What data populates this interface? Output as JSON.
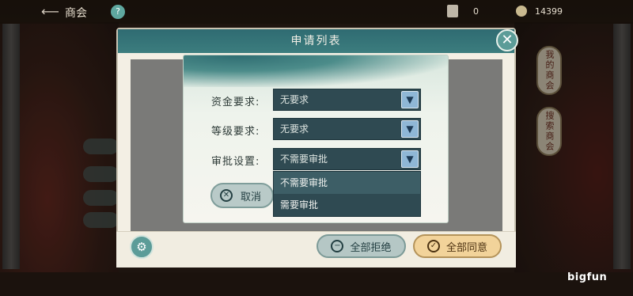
{
  "topbar": {
    "title": "商会",
    "res1_value": "0",
    "res2_value": "14399"
  },
  "right_tabs": [
    "我的商会",
    "搜索商会"
  ],
  "dialog": {
    "title": "申请列表",
    "reject_all": "全部拒绝",
    "accept_all": "全部同意"
  },
  "form": {
    "fund_label": "资金要求:",
    "fund_value": "无要求",
    "level_label": "等级要求:",
    "level_value": "无要求",
    "approval_label": "审批设置:",
    "approval_value": "不需要审批",
    "cancel_label": "取消",
    "approval_options": [
      "不需要审批",
      "需要审批"
    ]
  },
  "watermark": "bigfun"
}
